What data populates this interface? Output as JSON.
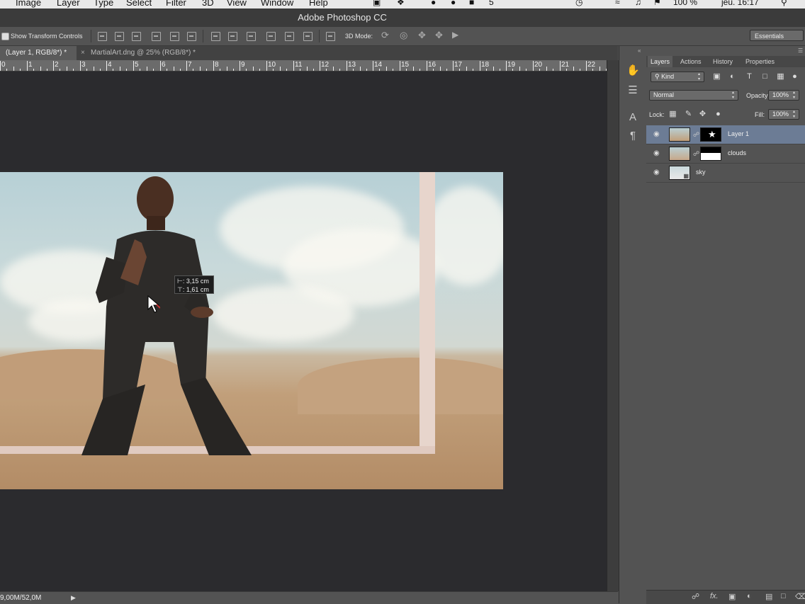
{
  "menubar": {
    "items": [
      "Image",
      "Layer",
      "Type",
      "Select",
      "Filter",
      "3D",
      "View",
      "Window",
      "Help"
    ],
    "battery": "100 %",
    "clock": "jeu. 16:17",
    "status_number": "5"
  },
  "window": {
    "title": "Adobe Photoshop CC"
  },
  "options_bar": {
    "show_transform_label": "Show Transform Controls",
    "mode_3d_label": "3D Mode:",
    "workspace": "Essentials"
  },
  "document_tabs": [
    {
      "label": "(Layer 1, RGB/8*) *",
      "active": true
    },
    {
      "label": "MartialArt.dng @ 25% (RGB/8*) *",
      "active": false
    }
  ],
  "ruler": {
    "labels": [
      "0",
      "1",
      "2",
      "3",
      "4",
      "5",
      "6",
      "7",
      "8",
      "9",
      "10",
      "11",
      "12",
      "13",
      "14",
      "15",
      "16",
      "17",
      "18",
      "19",
      "20",
      "21",
      "22"
    ]
  },
  "measure_tooltip": {
    "dx": "⊢: 3,15 cm",
    "dy": "⊤: 1,61 cm"
  },
  "status_bar": {
    "doc_size": "9,00M/52,0M"
  },
  "layers_panel": {
    "tabs": [
      "Layers",
      "Actions",
      "History",
      "Properties"
    ],
    "filter_label": "Kind",
    "blend_mode": "Normal",
    "opacity_label": "Opacity:",
    "opacity_value": "100%",
    "lock_label": "Lock:",
    "fill_label": "Fill:",
    "fill_value": "100%",
    "layers": [
      {
        "name": "Layer 1",
        "selected": true,
        "has_mask": true
      },
      {
        "name": "clouds",
        "selected": false,
        "has_mask": true
      },
      {
        "name": "sky",
        "selected": false,
        "has_mask": false
      }
    ]
  },
  "colors": {
    "selected_layer": "#6c7c95",
    "canvas_bg": "#2b2b2e",
    "panel_bg": "#535353"
  }
}
